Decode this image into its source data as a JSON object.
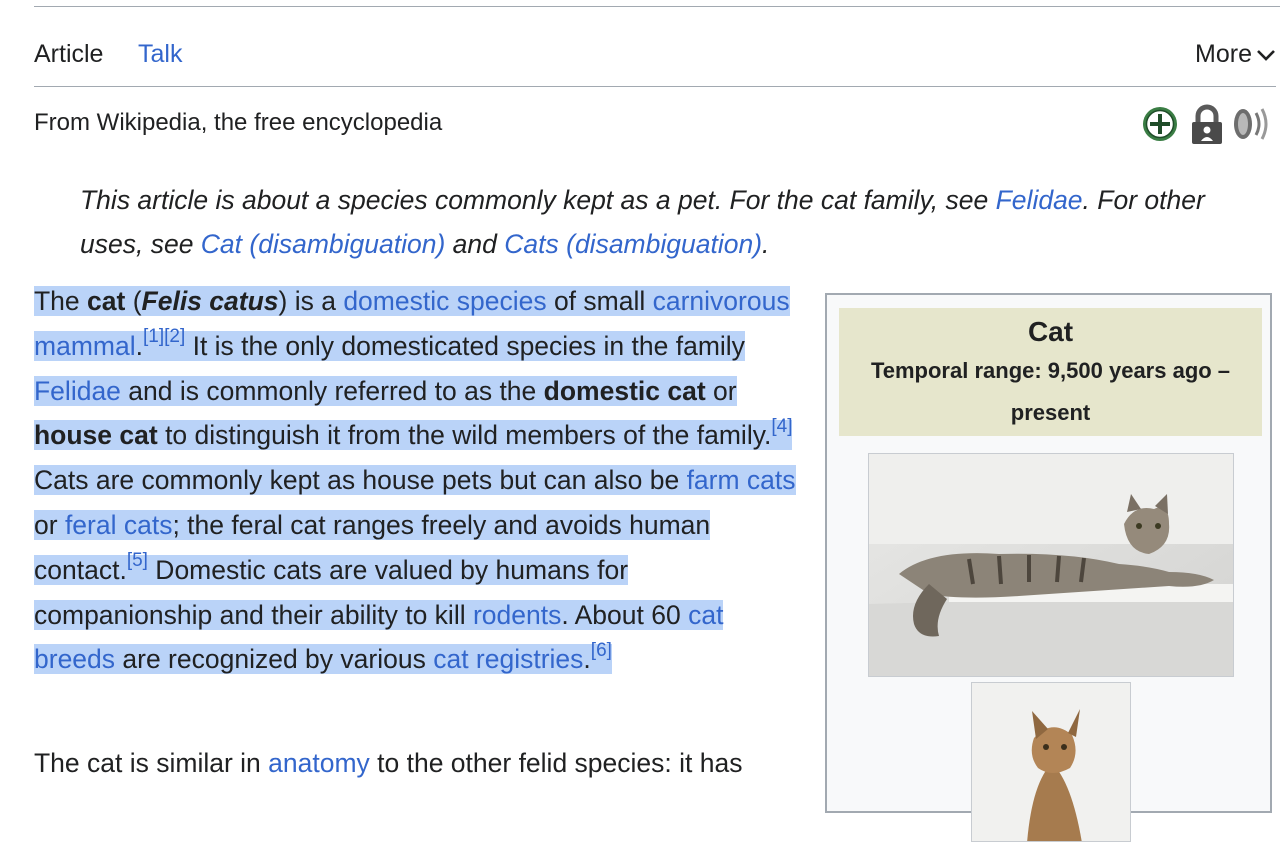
{
  "tabs": {
    "article": "Article",
    "talk": "Talk",
    "more": "More"
  },
  "tagline": "From Wikipedia, the free encyclopedia",
  "indicators": [
    "plus-icon",
    "lock-icon",
    "audio-icon"
  ],
  "hatnote": {
    "t1": "This article is about a species commonly kept as a pet. For the cat family, see ",
    "link1": "Felidae",
    "t2": ". For other uses, see ",
    "link2": "Cat (disambiguation)",
    "t3": " and ",
    "link3": "Cats (disambiguation)",
    "t4": "."
  },
  "lead": {
    "t_the": "The ",
    "b_cat": "cat",
    "t_paren_open": " (",
    "bi_felis": "Felis catus",
    "t_isa": ") is a ",
    "l_domestic_species": "domestic species",
    "t_of_small": " of small ",
    "l_carnivorous_mammal": "carnivorous mammal",
    "t_period1": ".",
    "ref1": "[1]",
    "ref2": "[2]",
    "t_only": " It is the only domesticated species in the family ",
    "l_felidae": "Felidae",
    "t_commonly": " and is commonly referred to as the ",
    "b_domestic_cat": "domestic cat",
    "t_or": " or ",
    "b_house_cat": "house cat",
    "t_distinguish": " to distinguish it from the wild members of the family.",
    "ref4": "[4]",
    "t_kept": " Cats are commonly kept as house pets but can also be ",
    "l_farm_cats": "farm cats",
    "t_or2": " or ",
    "l_feral_cats": "feral cats",
    "t_feral": "; the feral cat ranges freely and avoids human contact.",
    "ref5": "[5]",
    "t_valued": " Domestic cats are valued by humans for companionship and their ability to kill ",
    "l_rodents": "rodents",
    "t_about": ". About 60 ",
    "l_cat_breeds": "cat breeds",
    "t_recognized": " are recognized by various ",
    "l_cat_registries": "cat registries",
    "t_period2": ".",
    "ref6": "[6]"
  },
  "para2": {
    "t1": "The cat is similar in ",
    "l_anatomy": "anatomy",
    "t2": " to the other felid species: it has"
  },
  "infobox": {
    "title": "Cat",
    "range": "Temporal range: 9,500 years ago – present"
  },
  "colors": {
    "link": "#3366cc",
    "selection": "#bad3f8",
    "infobox_header": "#e6e6cc"
  }
}
